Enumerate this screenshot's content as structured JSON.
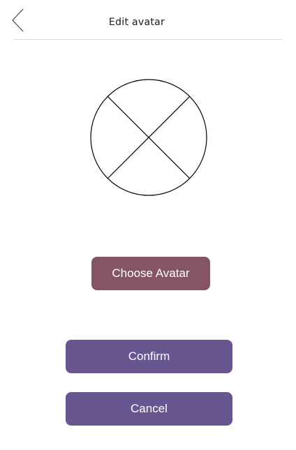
{
  "header": {
    "title": "Edit avatar",
    "back_icon": "chevron-left-icon"
  },
  "avatar": {
    "icon": "avatar-placeholder-icon"
  },
  "buttons": {
    "choose_avatar": "Choose Avatar",
    "confirm": "Confirm",
    "cancel": "Cancel"
  },
  "colors": {
    "choose_button": "#855564",
    "primary_button": "#685690",
    "divider": "#d9d9d9"
  }
}
